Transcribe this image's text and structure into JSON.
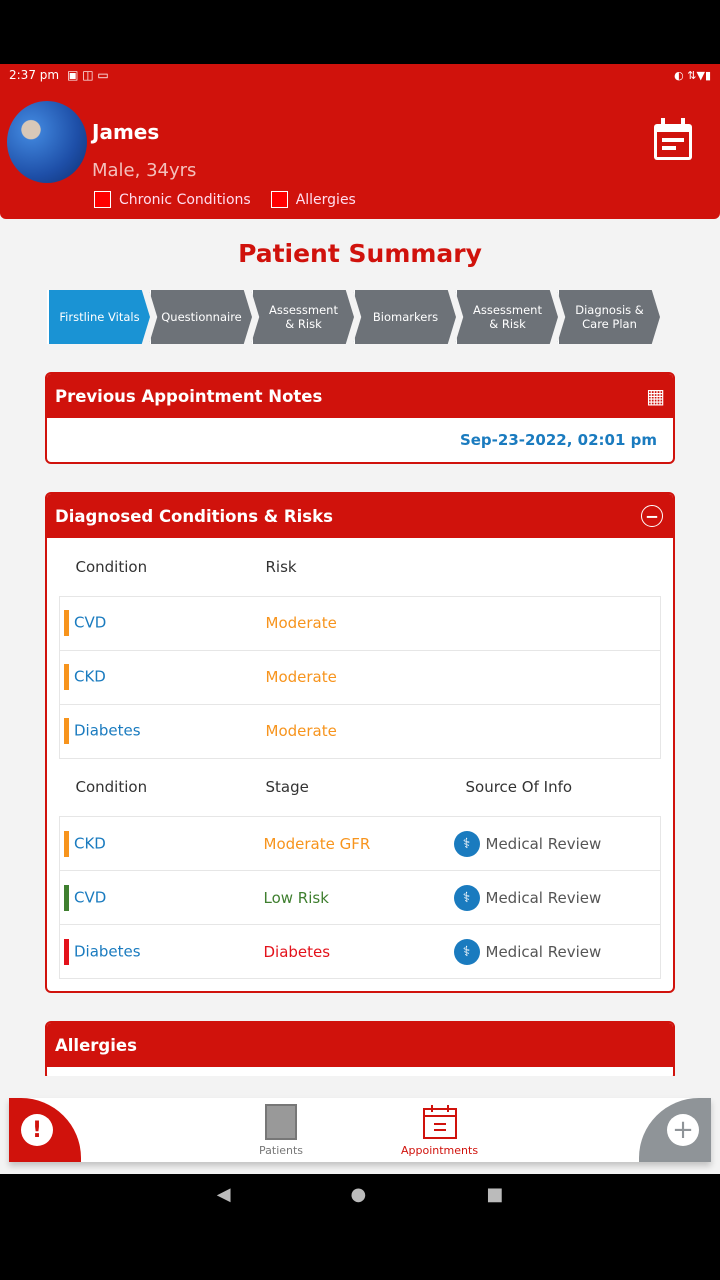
{
  "status": {
    "time": "2:37 pm",
    "icons": "▣ ◫ ▭",
    "right": "◐ ⇅▼▮"
  },
  "patient": {
    "name": "James",
    "details": "Male, 34yrs",
    "tags": [
      "Chronic Conditions",
      "Allergies"
    ]
  },
  "page_title": "Patient Summary",
  "steps": [
    {
      "label": "Firstline Vitals",
      "active": true
    },
    {
      "label": "Questionnaire"
    },
    {
      "label": "Assessment & Risk"
    },
    {
      "label": "Biomarkers"
    },
    {
      "label": "Assessment & Risk"
    },
    {
      "label": "Diagnosis & Care Plan"
    }
  ],
  "notes": {
    "title": "Previous Appointment Notes",
    "date": "Sep-23-2022, 02:01 pm"
  },
  "conditions": {
    "title": "Diagnosed Conditions & Risks",
    "risk_headers": [
      "Condition",
      "Risk"
    ],
    "risks": [
      {
        "condition": "CVD",
        "risk": "Moderate",
        "color": "#f7941d"
      },
      {
        "condition": "CKD",
        "risk": "Moderate",
        "color": "#f7941d"
      },
      {
        "condition": "Diabetes",
        "risk": "Moderate",
        "color": "#f7941d"
      }
    ],
    "stage_headers": [
      "Condition",
      "Stage",
      "Source Of Info"
    ],
    "stages": [
      {
        "condition": "CKD",
        "stage": "Moderate GFR",
        "source": "Medical Review",
        "color": "#f7941d"
      },
      {
        "condition": "CVD",
        "stage": "Low Risk",
        "source": "Medical Review",
        "color": "#3f7f2f"
      },
      {
        "condition": "Diabetes",
        "stage": "Diabetes",
        "source": "Medical Review",
        "color": "#e3121b"
      }
    ]
  },
  "allergies": {
    "title": "Allergies"
  },
  "nav": {
    "patients": "Patients",
    "appointments": "Appointments"
  },
  "colors": {
    "brand": "#d0120c",
    "active_step": "#1a93d4"
  }
}
